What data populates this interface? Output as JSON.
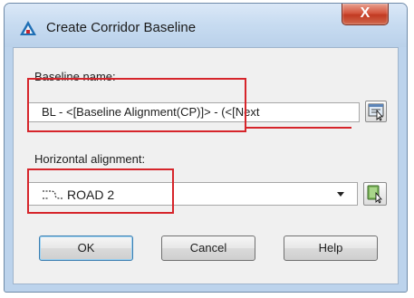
{
  "window": {
    "title": "Create Corridor Baseline",
    "close_glyph": "X",
    "app_icon": "autocad-civil3d-icon"
  },
  "baseline_name": {
    "label": "Baseline name:",
    "value": "BL - <[Baseline Alignment(CP)]> - (<[Next",
    "pick_icon": "pick-from-drawing-icon"
  },
  "horizontal_alignment": {
    "label": "Horizontal alignment:",
    "selected": "ROAD 2",
    "item_icon": "alignment-icon",
    "pick_icon": "select-alignment-in-drawing-icon"
  },
  "buttons": {
    "ok": "OK",
    "cancel": "Cancel",
    "help": "Help"
  },
  "annotations": {
    "highlight_color": "#d6252b"
  }
}
